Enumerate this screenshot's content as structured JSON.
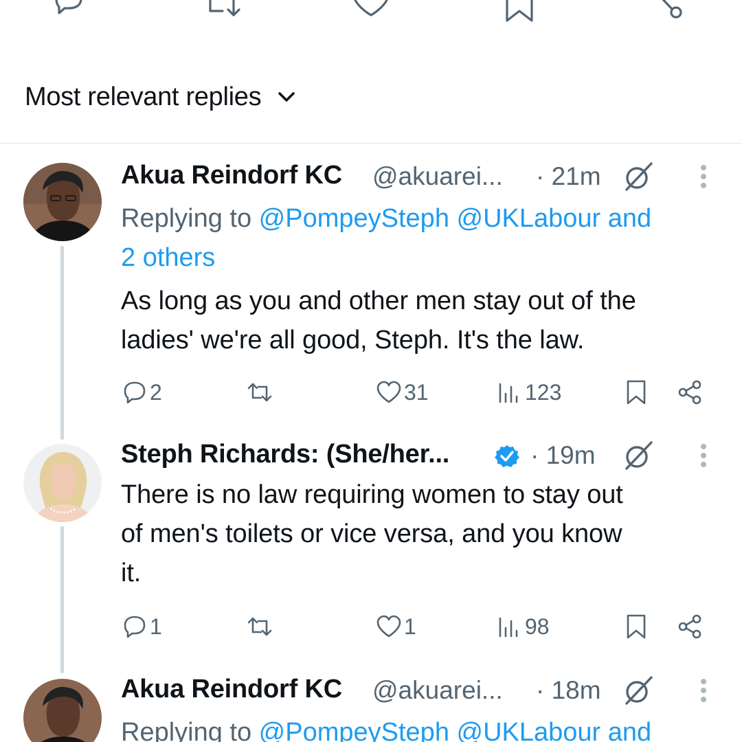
{
  "top_actions": {
    "icons": [
      "reply-icon",
      "retweet-icon",
      "like-icon",
      "bookmark-icon",
      "share-icon"
    ]
  },
  "sort": {
    "label": "Most relevant replies",
    "icon": "chevron-down-icon"
  },
  "tweets": [
    {
      "name": "Akua Reindorf KC",
      "handle": "@akuarei...",
      "time": "· 21m",
      "replying_prefix": "Replying to ",
      "replying_links": "@PompeySteph @UKLabour and",
      "replying_links_2": "2 others",
      "text_line_1": "As long as you and other men stay out of the",
      "text_line_2": "ladies' we're all good, Steph. It's the law.",
      "replies": "2",
      "retweets": "",
      "likes": "31",
      "views": "123"
    },
    {
      "name": "Steph Richards: (She/her...",
      "verified": true,
      "time": "· 19m",
      "text_line_1": "There is no law requiring women to stay out",
      "text_line_2": "of men's toilets or vice versa, and you know",
      "text_line_3": "it.",
      "replies": "1",
      "retweets": "",
      "likes": "1",
      "views": "98"
    },
    {
      "name": "Akua Reindorf KC",
      "handle": "@akuarei...",
      "time": "· 18m",
      "replying_prefix": "Replying to ",
      "replying_links": "@PompeySteph @UKLabour and"
    }
  ],
  "colors": {
    "text": "#0f1419",
    "secondary": "#536471",
    "link": "#1d9bf0",
    "thread_line": "#cfd9de",
    "verified": "#1d9bf0"
  }
}
